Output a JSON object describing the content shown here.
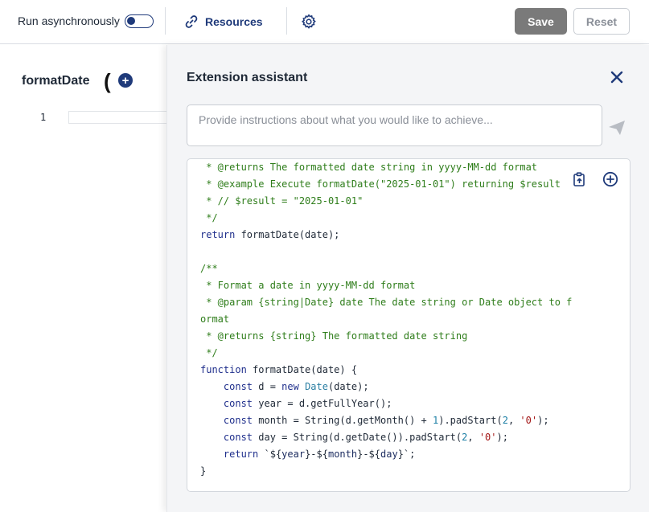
{
  "toolbar": {
    "async_label": "Run asynchronously",
    "async_enabled": false,
    "resources_label": "Resources",
    "save_label": "Save",
    "reset_label": "Reset",
    "icons": {
      "resources": "link-icon",
      "settings": "gear-icon"
    }
  },
  "editor": {
    "function_name": "formatDate",
    "open_paren": "(",
    "add_param_symbol": "+",
    "line_number": "1"
  },
  "assistant": {
    "title": "Extension assistant",
    "prompt_placeholder": "Provide instructions about what you would like to achieve...",
    "icons": {
      "close": "close-icon",
      "send": "send-icon",
      "copy": "copy-icon",
      "insert": "plus-circle-icon"
    },
    "code_lines": [
      " * @returns The formatted date string in yyyy-MM-dd format",
      " * @example Execute formatDate(\"2025-01-01\") returning $result",
      " * // $result = \"2025-01-01\"",
      " */",
      "return formatDate(date);",
      "",
      "/**",
      " * Format a date in yyyy-MM-dd format",
      " * @param {string|Date} date The date string or Date object to f",
      "ormat",
      " * @returns {string} The formatted date string",
      " */",
      "function formatDate(date) {",
      "    const d = new Date(date);",
      "    const year = d.getFullYear();",
      "    const month = String(d.getMonth() + 1).padStart(2, '0');",
      "    const day = String(d.getDate()).padStart(2, '0');",
      "    return `${year}-${month}-${day}`;",
      "}"
    ]
  },
  "colors": {
    "accent": "#1f3a7a",
    "save_bg": "#7a7a7a",
    "comment": "#2e7d1a",
    "keyword": "#1f2f8c",
    "string": "#a31515",
    "number": "#1a7ea5"
  }
}
